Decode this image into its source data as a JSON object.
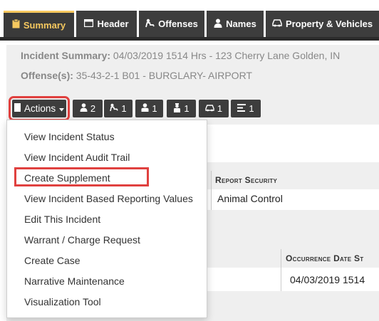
{
  "tabs": [
    {
      "label": "Summary",
      "icon": "clipboard-icon"
    },
    {
      "label": "Header",
      "icon": "window-icon"
    },
    {
      "label": "Offenses",
      "icon": "offense-icon"
    },
    {
      "label": "Names",
      "icon": "person-icon"
    },
    {
      "label": "Property & Vehicles",
      "icon": "car-icon"
    }
  ],
  "summary": {
    "incident_label": "Incident Summary:",
    "incident_value": " 04/03/2019 1514 Hrs - 123 Cherry Lane Golden, IN",
    "offense_label": "Offense(s):",
    "offense_value": " 35-43-2-1 B01 - BURGLARY- AIRPORT"
  },
  "actions": {
    "label": "Actions",
    "counts": [
      "2",
      "1",
      "1",
      "1",
      "1",
      "1"
    ],
    "menu_items": [
      "View Incident Status",
      "View Incident Audit Trail",
      "Create Supplement",
      "View Incident Based Reporting Values",
      "Edit This Incident",
      "Warrant / Charge Request",
      "Create Case",
      "Narrative Maintenance",
      "Visualization Tool"
    ]
  },
  "background": {
    "report_security_header": "Report Security",
    "report_security_value": "Animal Control",
    "occurrence_header": "Occurrence Date St",
    "occurrence_value": "04/03/2019 1514"
  },
  "colors": {
    "highlight": "#e0413f",
    "active_tab": "#f6c85f",
    "dark": "#3d3d3d"
  }
}
